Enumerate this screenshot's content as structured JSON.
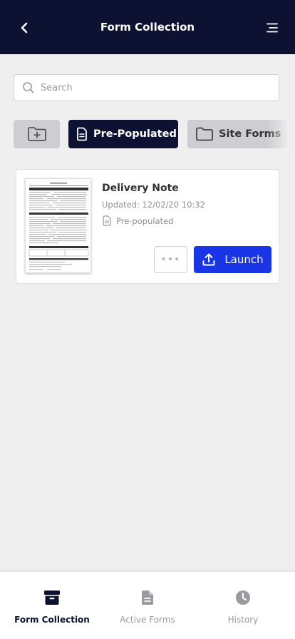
{
  "header": {
    "title": "Form Collection",
    "back_icon": "chevron-left-icon",
    "menu_icon": "hamburger-menu-icon"
  },
  "search": {
    "placeholder": "Search",
    "value": "",
    "icon": "search-icon"
  },
  "filters": [
    {
      "label": "",
      "icon": "folder-plus-icon"
    },
    {
      "label": "Pre-Populated",
      "icon": "document-icon",
      "active": true
    },
    {
      "label": "Site Forms",
      "icon": "folder-icon"
    }
  ],
  "forms": [
    {
      "name": "Delivery Note",
      "updated": "Updated: 12/02/20 10:32",
      "type": "Pre-populated",
      "more_label": "•••",
      "launch_label": "Launch"
    }
  ],
  "tabs": [
    {
      "label": "Form Collection",
      "icon": "archive-box-icon",
      "active": true
    },
    {
      "label": "Active Forms",
      "icon": "file-text-icon",
      "active": false
    },
    {
      "label": "History",
      "icon": "clock-icon",
      "active": false
    }
  ],
  "colors": {
    "primary": "#0d1233",
    "accent": "#1a35e6",
    "background": "#efeff0",
    "chip_inactive": "#cdcdd2"
  }
}
